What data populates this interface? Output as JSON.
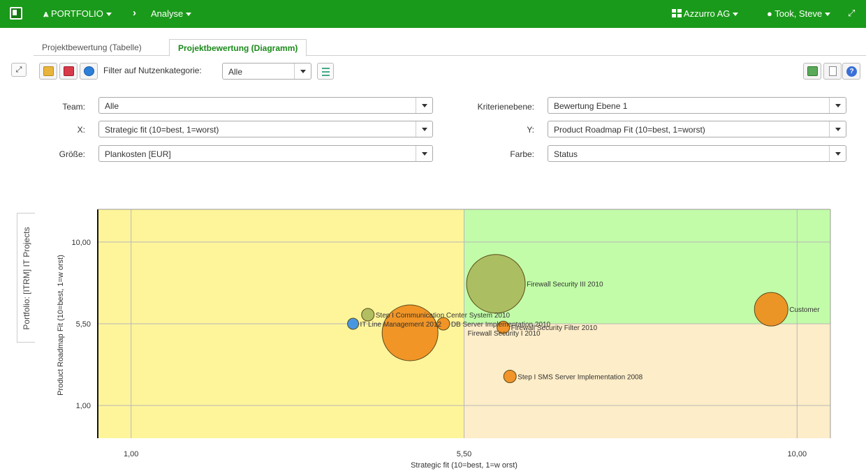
{
  "topbar": {
    "portfolio": "PORTFOLIO",
    "breadcrumb_sep": "›",
    "analyse": "Analyse",
    "company": "Azzurro AG",
    "user": "Took, Steve"
  },
  "tabs": [
    {
      "label": "Projektbewertung (Tabelle)",
      "active": false
    },
    {
      "label": "Projektbewertung (Diagramm)",
      "active": true
    }
  ],
  "side_tab": "Portfolio: [ITRM] IT Projects",
  "toolbar": {
    "filter_label": "Filter auf Nutzenkategorie:",
    "filter_value": "Alle"
  },
  "form": {
    "team_label": "Team:",
    "team_value": "Alle",
    "x_label": "X:",
    "x_value": "Strategic fit (10=best, 1=worst)",
    "size_label": "Größe:",
    "size_value": "Plankosten [EUR]",
    "level_label": "Kriterienebene:",
    "level_value": "Bewertung Ebene 1",
    "y_label": "Y:",
    "y_value": "Product Roadmap Fit (10=best, 1=worst)",
    "color_label": "Farbe:",
    "color_value": "Status"
  },
  "chart_data": {
    "type": "scatter",
    "xlabel": "Strategic fit (10=best, 1=w orst)",
    "ylabel": "Product Roadmap Fit (10=best, 1=w orst)",
    "xlim": [
      0.55,
      10.45
    ],
    "ylim": [
      -0.8,
      11.8
    ],
    "xticks": [
      {
        "value": 1,
        "label": "1,00"
      },
      {
        "value": 5.5,
        "label": "5,50"
      },
      {
        "value": 10,
        "label": "10,00"
      }
    ],
    "yticks": [
      {
        "value": 1,
        "label": "1,00"
      },
      {
        "value": 5.5,
        "label": "5,50"
      },
      {
        "value": 10,
        "label": "10,00"
      }
    ],
    "quadrants": {
      "split_x": 5.5,
      "split_y": 5.5,
      "colors": {
        "left": "#fef59a",
        "top_right": "#c2fca8",
        "bottom_right": "#fdedc8"
      }
    },
    "colors": {
      "orange": "#f08c1c",
      "green": "#aab85c",
      "blue": "#3a8ee6"
    },
    "points": [
      {
        "label": "Firewall Security III 2010",
        "x": 5.93,
        "y": 7.7,
        "r": 42,
        "color": "green"
      },
      {
        "label": "Customer",
        "x": 9.65,
        "y": 6.3,
        "r": 24,
        "color": "orange"
      },
      {
        "label": "Step I Communication Center System 2010",
        "x": 4.2,
        "y": 6.0,
        "r": 9,
        "color": "green"
      },
      {
        "label": "IT Line Management 2012",
        "x": 4.0,
        "y": 5.5,
        "r": 8,
        "color": "blue"
      },
      {
        "label": "",
        "x": 4.77,
        "y": 5.0,
        "r": 40,
        "color": "orange"
      },
      {
        "label": "DB Server Implementation 2010",
        "x": 5.22,
        "y": 5.5,
        "r": 9,
        "color": "orange"
      },
      {
        "label": "Firewall Security I 2010",
        "x": 5.53,
        "y": 5.0,
        "r": 0,
        "color": "orange"
      },
      {
        "label": "Firewall Security Filter 2010",
        "x": 6.03,
        "y": 5.3,
        "r": 9,
        "color": "orange"
      },
      {
        "label": "Step I SMS Server Implementation 2008",
        "x": 6.12,
        "y": 2.6,
        "r": 9,
        "color": "orange"
      }
    ]
  }
}
